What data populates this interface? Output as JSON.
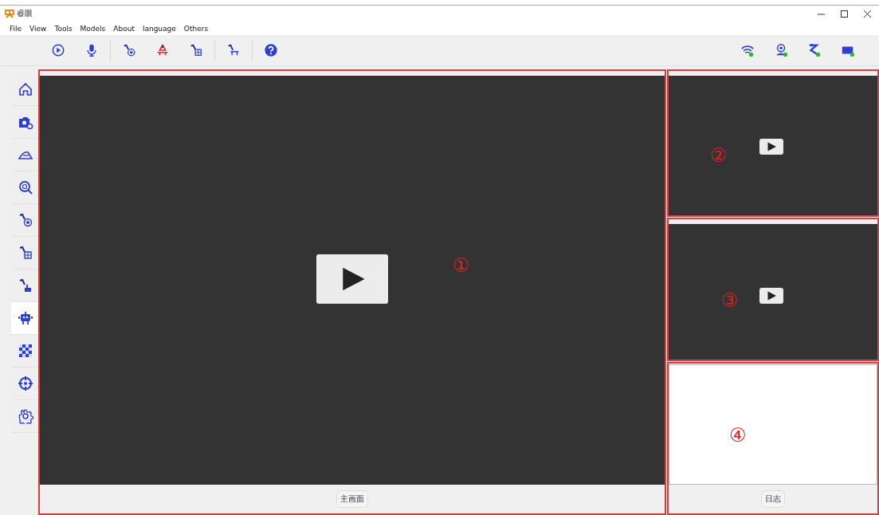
{
  "window": {
    "title": "睿眼"
  },
  "menu": [
    "File",
    "View",
    "Tools",
    "Models",
    "About",
    "language",
    "Others"
  ],
  "toolbar": [
    {
      "kind": "play"
    },
    {
      "kind": "mic"
    },
    {
      "kind": "sep"
    },
    {
      "kind": "arm-target"
    },
    {
      "kind": "arm-red"
    },
    {
      "kind": "arm-box"
    },
    {
      "kind": "sep"
    },
    {
      "kind": "arm-seat"
    },
    {
      "kind": "sep"
    },
    {
      "kind": "help"
    }
  ],
  "status_icons": [
    {
      "kind": "wifi"
    },
    {
      "kind": "camera"
    },
    {
      "kind": "arm"
    },
    {
      "kind": "gpu"
    }
  ],
  "sidebar": {
    "items": [
      {
        "kind": "home",
        "selected": false
      },
      {
        "kind": "camera",
        "selected": false
      },
      {
        "kind": "slide",
        "selected": false
      },
      {
        "kind": "zoom",
        "selected": false
      },
      {
        "kind": "arm-target",
        "selected": false
      },
      {
        "kind": "arm-box",
        "selected": false
      },
      {
        "kind": "arm-hand",
        "selected": false
      },
      {
        "kind": "robot",
        "selected": true
      },
      {
        "kind": "checker",
        "selected": false
      },
      {
        "kind": "crosshair",
        "selected": false
      },
      {
        "kind": "gear",
        "selected": false
      }
    ]
  },
  "main_panel": {
    "marker": "①",
    "button": "主画面"
  },
  "side_panels": [
    {
      "marker": "②"
    },
    {
      "marker": "③"
    }
  ],
  "log_panel": {
    "marker": "④",
    "button": "日志"
  }
}
